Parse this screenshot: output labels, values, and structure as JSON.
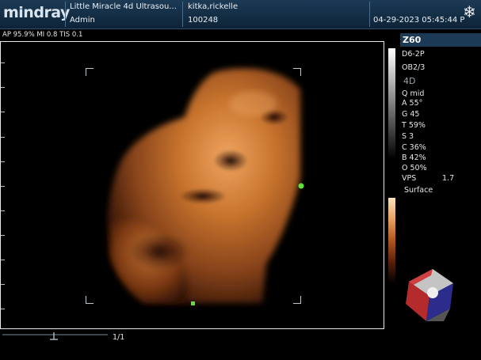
{
  "header": {
    "brand": "mindray",
    "institution": "Little Miracle 4d Ultrasou...",
    "operator": "Admin",
    "patient_name": "kitka,rickelle",
    "patient_id": "100248",
    "datetime": "04-29-2023  05:45:44 P",
    "freeze_icon": "snowflake-icon"
  },
  "params_line": "AP 95.9%  MI 0.8 TIS 0.1",
  "right_panel": {
    "probe_badge": "Z60",
    "probe": "D6-2P",
    "exam": "OB2/3",
    "mode": "4D",
    "rows": [
      "Q mid",
      "A 55°",
      "G 45",
      "T 59%",
      "S 3",
      "C 36%",
      "B 42%",
      "O 50%"
    ],
    "vps_label": "VPS",
    "vps_value": "1.7",
    "render_mode": "Surface",
    "orientation_icon": "orientation-cube-icon"
  },
  "footer": {
    "pager": "1/1"
  },
  "colors": {
    "header_bg": "#1c3a55",
    "marker_green": "#5ee03a",
    "image_tone": "#c06a28"
  }
}
